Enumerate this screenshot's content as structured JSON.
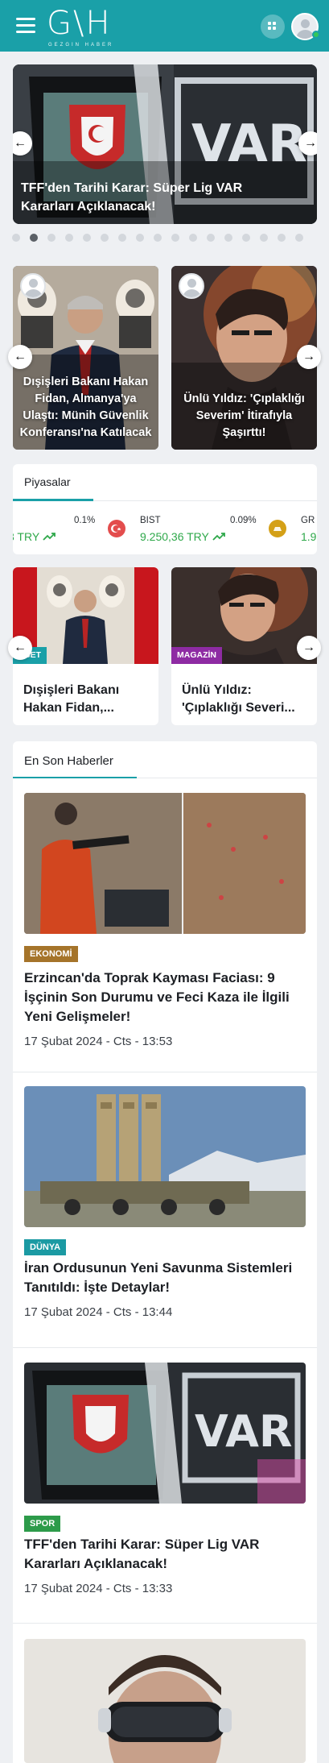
{
  "header": {
    "logo_text": "G\\H",
    "logo_subtitle": "GEZGİN HABER",
    "menu_icon": "hamburger-icon",
    "grid_icon": "grid-icon",
    "avatar_icon": "user-avatar-icon",
    "accent_color": "#1aa0a8"
  },
  "hero": {
    "title": "TFF'den Tarihi Karar: Süper Lig VAR Kararları Açıklanacak!",
    "art_text": "VAR",
    "active_slide": 1,
    "slide_count": 17
  },
  "author_cards": [
    {
      "title": "Dışişleri Bakanı Hakan Fidan, Almanya'ya Ulaştı: Münih Güvenlik Konferansı'na Katılacak"
    },
    {
      "title": "Ünlü Yıldız: 'Çıplaklığı Severim' İtirafıyla Şaşırttı!"
    }
  ],
  "markets": {
    "title": "Piyasalar",
    "items": [
      {
        "name": "",
        "pct": "0.1%",
        "value": "3 TRY",
        "trend": "up"
      },
      {
        "name": "BIST",
        "pct": "0.09%",
        "value": "9.250,36 TRY",
        "trend": "up"
      },
      {
        "name": "GR",
        "pct": "",
        "value": "1.9",
        "trend": "up"
      }
    ]
  },
  "category_cards": [
    {
      "badge": "SİYASET",
      "badge_visible": "ASET",
      "badge_color": "#1aa0a8",
      "title": "Dışişleri Bakanı Hakan Fidan,..."
    },
    {
      "badge": "MAGAZİN",
      "badge_visible": "MAGAZİN",
      "badge_color": "#8e2ba3",
      "title": "Ünlü Yıldız: 'Çıplaklığı Severi..."
    }
  ],
  "latest": {
    "title": "En Son Haberler",
    "items": [
      {
        "category": "EKONOMİ",
        "category_color": "#a5742a",
        "title": "Erzincan'da Toprak Kayması Faciası: 9 İşçinin Son Durumu ve Feci Kaza ile İlgili Yeni Gelişmeler!",
        "date": "17 Şubat 2024 - Cts - 13:53"
      },
      {
        "category": "DÜNYA",
        "category_color": "#1b9aa3",
        "title": "İran Ordusunun Yeni Savunma Sistemleri Tanıtıldı: İşte Detaylar!",
        "date": "17 Şubat 2024 - Cts - 13:44"
      },
      {
        "category": "SPOR",
        "category_color": "#2d9b4a",
        "title": "TFF'den Tarihi Karar: Süper Lig VAR Kararları Açıklanacak!",
        "date": "17 Şubat 2024 - Cts - 13:33"
      }
    ]
  }
}
